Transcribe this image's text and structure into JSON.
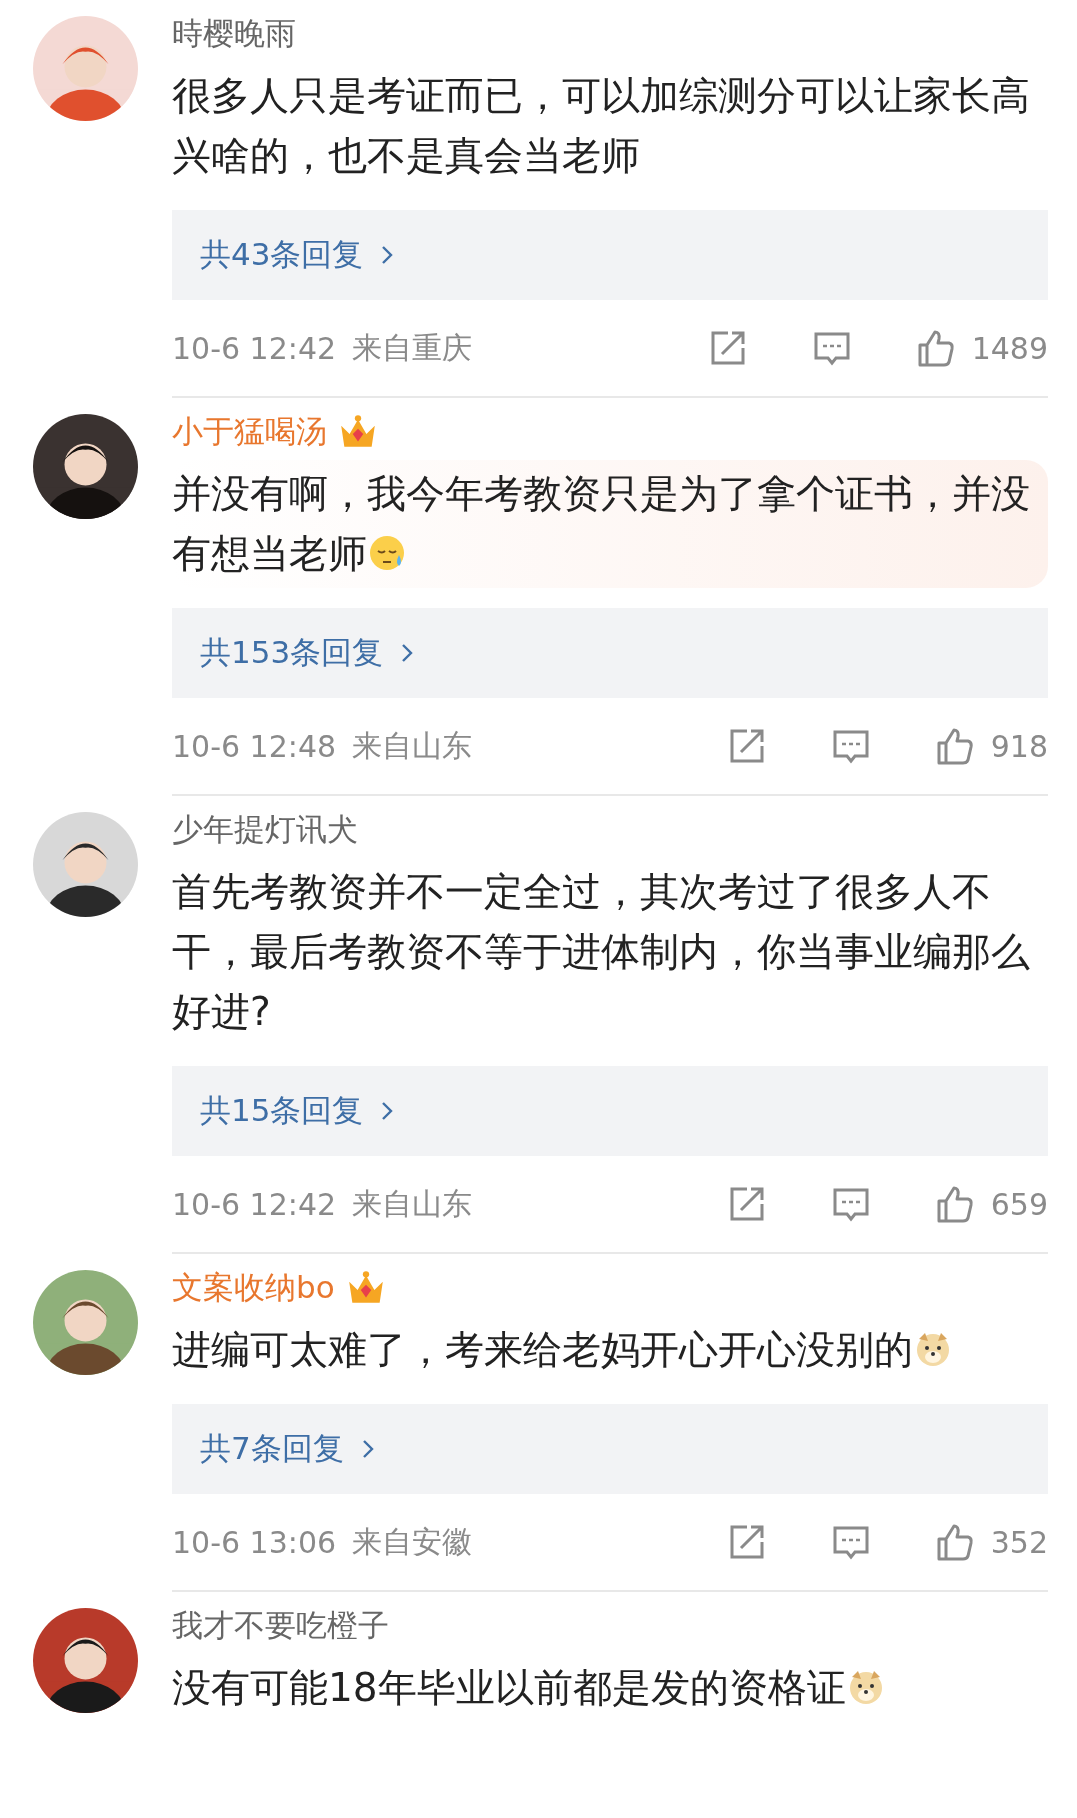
{
  "comments": [
    {
      "name": "時樱晚雨",
      "vip": false,
      "highlighted": false,
      "text": "很多人只是考证而已，可以加综测分可以让家长高兴啥的，也不是真会当老师",
      "replies": "共43条回复",
      "time": "10-6 12:42",
      "location": "来自重庆",
      "likes": "1489"
    },
    {
      "name": "小于猛喝汤",
      "vip": true,
      "highlighted": true,
      "text": "并没有啊，我今年考教资只是为了拿个证书，并没有想当老师",
      "emoji": {
        "kind": "sweat"
      },
      "replies": "共153条回复",
      "time": "10-6 12:48",
      "location": "来自山东",
      "likes": "918"
    },
    {
      "name": "少年提灯讯犬",
      "vip": false,
      "highlighted": false,
      "text": "首先考教资并不一定全过，其次考过了很多人不干，最后考教资不等于进体制内，你当事业编那么好进?",
      "replies": "共15条回复",
      "time": "10-6 12:42",
      "location": "来自山东",
      "likes": "659"
    },
    {
      "name": "文案收纳bo",
      "vip": true,
      "highlighted": false,
      "text": "进编可太难了，考来给老妈开心开心没别的",
      "emoji": {
        "kind": "doge"
      },
      "replies": "共7条回复",
      "time": "10-6 13:06",
      "location": "来自安徽",
      "likes": "352"
    },
    {
      "name": "我才不要吃橙子",
      "vip": false,
      "highlighted": false,
      "text": "没有可能18年毕业以前都是发的资格证",
      "emoji": {
        "kind": "doge"
      }
    }
  ]
}
